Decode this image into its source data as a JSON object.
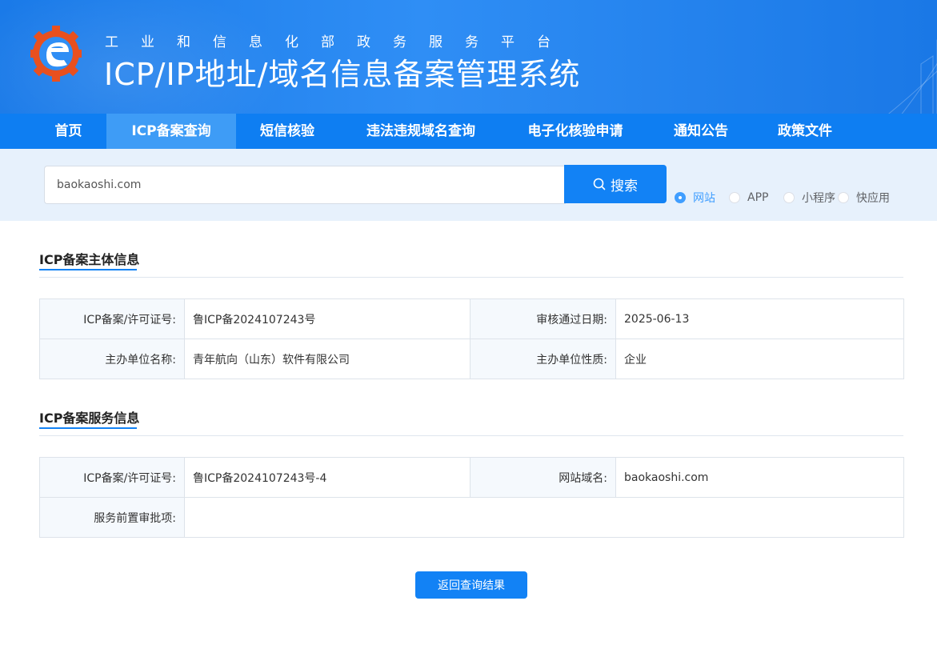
{
  "header": {
    "subtitle": "工业和信息化部政务服务平台",
    "title": "ICP/IP地址/域名信息备案管理系统",
    "logo_icon": "miit-gear-logo-icon"
  },
  "nav": {
    "items": [
      {
        "label": "首页"
      },
      {
        "label": "ICP备案查询"
      },
      {
        "label": "短信核验"
      },
      {
        "label": "违法违规域名查询"
      },
      {
        "label": "电子化核验申请"
      },
      {
        "label": "通知公告"
      },
      {
        "label": "政策文件"
      }
    ],
    "active_index": 1
  },
  "search": {
    "value": "baokaoshi.com",
    "button_label": "搜索",
    "options": [
      {
        "label": "网站",
        "checked": true
      },
      {
        "label": "APP",
        "checked": false
      },
      {
        "label": "小程序",
        "checked": false
      },
      {
        "label": "快应用",
        "checked": false
      }
    ]
  },
  "subject_section": {
    "title": "ICP备案主体信息",
    "rows": [
      {
        "label1": "ICP备案/许可证号:",
        "value1": "鲁ICP备2024107243号",
        "label2": "审核通过日期:",
        "value2": "2025-06-13"
      },
      {
        "label1": "主办单位名称:",
        "value1": "青年航向（山东）软件有限公司",
        "label2": "主办单位性质:",
        "value2": "企业"
      }
    ]
  },
  "service_section": {
    "title": "ICP备案服务信息",
    "row1": {
      "label1": "ICP备案/许可证号:",
      "value1": "鲁ICP备2024107243号-4",
      "label2": "网站域名:",
      "value2": "baokaoshi.com"
    },
    "row2": {
      "label": "服务前置审批项:",
      "value": ""
    }
  },
  "back_button_label": "返回查询结果",
  "colors": {
    "primary": "#1282f5",
    "nav_bg": "#0e7ef2",
    "nav_active": "#3e9cf6",
    "search_band": "#e7f1fc",
    "label_cell_bg": "#f5f9fd"
  }
}
